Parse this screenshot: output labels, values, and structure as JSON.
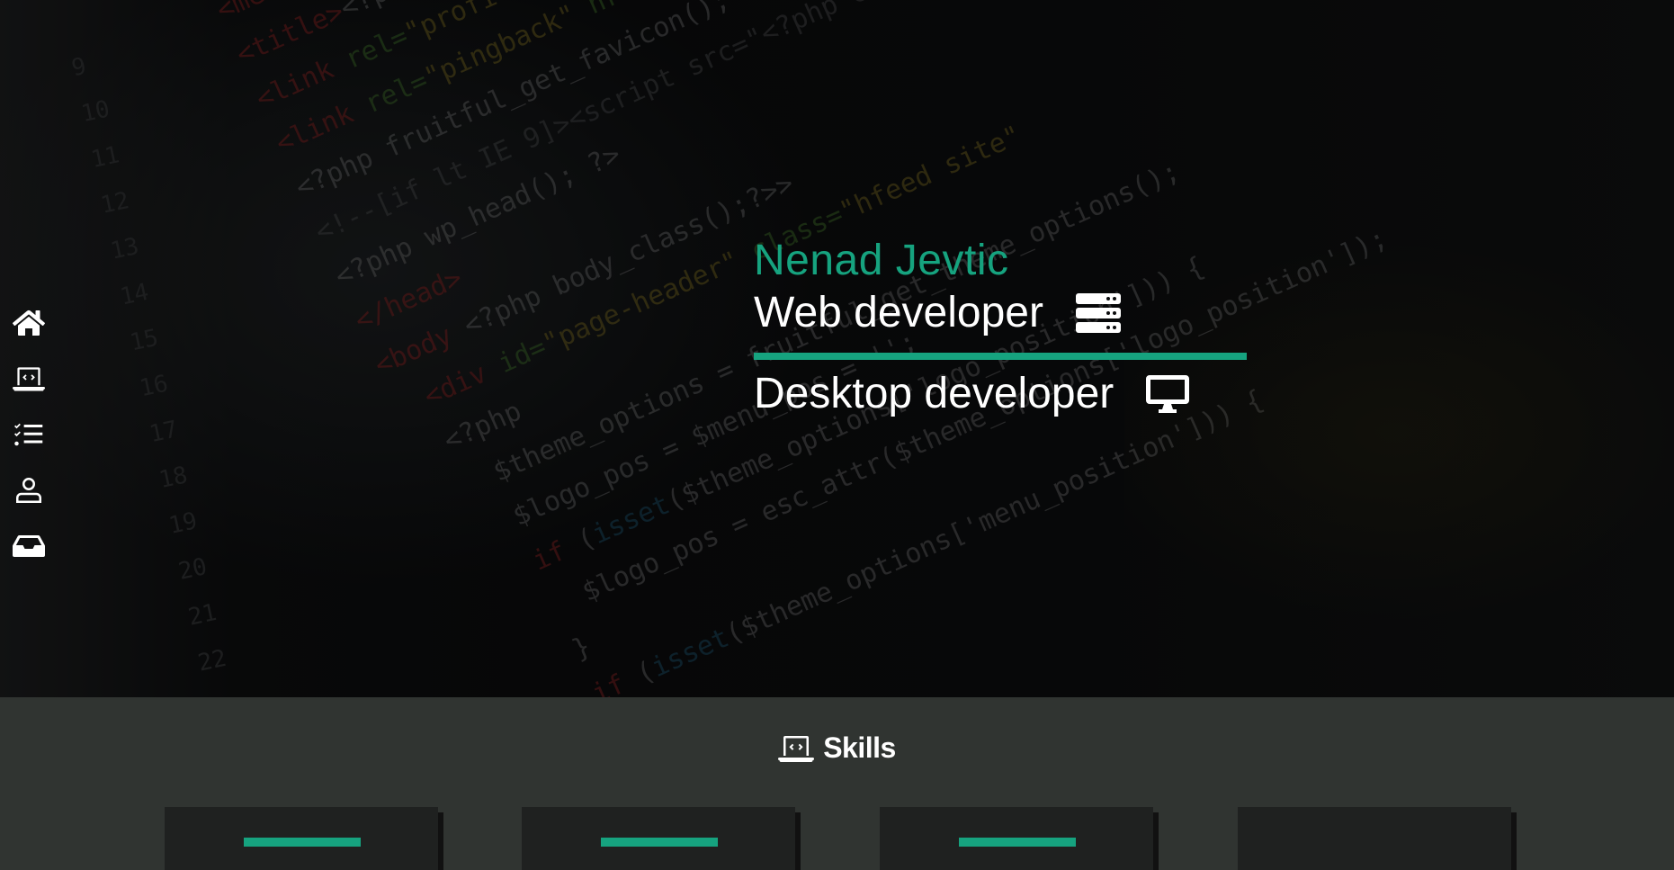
{
  "sidebar": {
    "items": [
      {
        "name": "home",
        "icon": "home-icon"
      },
      {
        "name": "skills",
        "icon": "laptop-code-icon"
      },
      {
        "name": "projects",
        "icon": "task-list-icon"
      },
      {
        "name": "about",
        "icon": "user-icon"
      },
      {
        "name": "contact",
        "icon": "inbox-icon"
      }
    ]
  },
  "hero": {
    "name": "Nenad Jevtic",
    "roles": [
      {
        "label": "Web developer",
        "icon": "server-icon"
      },
      {
        "label": "Desktop developer",
        "icon": "desktop-icon"
      }
    ]
  },
  "skills": {
    "title": "Skills",
    "icon": "laptop-code-icon"
  },
  "colors": {
    "accent": "#16a37f",
    "section_bg": "#303431",
    "card_bg": "#1f2120"
  }
}
